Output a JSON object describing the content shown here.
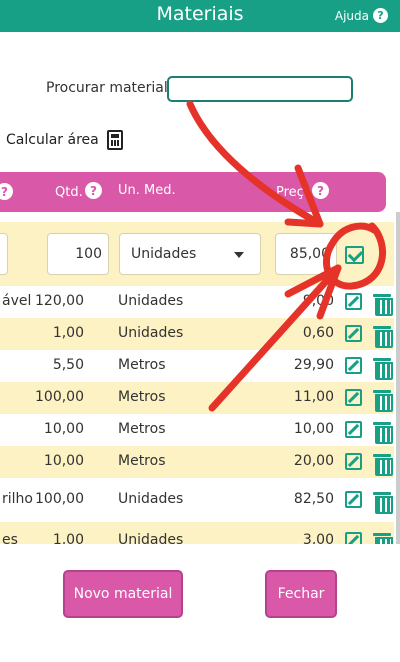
{
  "header": {
    "title": "Materiais",
    "help_label": "Ajuda",
    "help_glyph": "?"
  },
  "search": {
    "label": "Procurar material:",
    "value": "",
    "placeholder": ""
  },
  "calc": {
    "label": "Calcular área",
    "icon": "calculator-icon"
  },
  "table": {
    "headers": {
      "help_glyph": "?",
      "qtd": "Qtd.",
      "un": "Un. Med.",
      "preco": "Preço"
    },
    "edit_row": {
      "qtd": "100",
      "un": "Unidades",
      "preco": "85,00"
    },
    "rows": [
      {
        "mat": "ável",
        "qtd": "120,00",
        "un": "Unidades",
        "preco": "9,00"
      },
      {
        "mat": "",
        "qtd": "1,00",
        "un": "Unidades",
        "preco": "0,60"
      },
      {
        "mat": "",
        "qtd": "5,50",
        "un": "Metros",
        "preco": "29,90"
      },
      {
        "mat": "",
        "qtd": "100,00",
        "un": "Metros",
        "preco": "11,00"
      },
      {
        "mat": "",
        "qtd": "10,00",
        "un": "Metros",
        "preco": "10,00"
      },
      {
        "mat": "",
        "qtd": "10,00",
        "un": "Metros",
        "preco": "20,00"
      },
      {
        "mat": "rilho",
        "qtd": "100,00",
        "un": "Unidades",
        "preco": "82,50"
      },
      {
        "mat": "es",
        "qtd": "1,00",
        "un": "Unidades",
        "preco": "3,00"
      }
    ]
  },
  "buttons": {
    "new": "Novo material",
    "close": "Fechar"
  },
  "colors": {
    "primary": "#17a085",
    "accent": "#d958a8",
    "row_alt": "#fcf2c3",
    "annotation": "#e5332a"
  }
}
